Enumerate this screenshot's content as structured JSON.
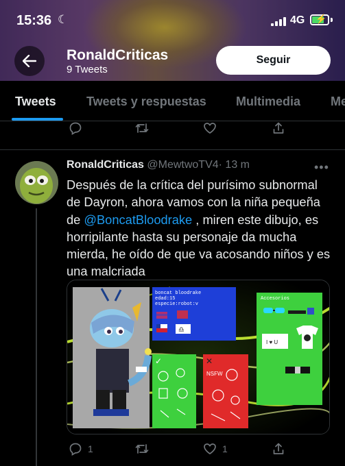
{
  "status_bar": {
    "time": "15:36",
    "network": "4G"
  },
  "header": {
    "name": "RonaldCriticas",
    "tweet_count": "9 Tweets",
    "follow_label": "Seguir"
  },
  "tabs": [
    {
      "label": "Tweets",
      "active": true
    },
    {
      "label": "Tweets y respuestas",
      "active": false
    },
    {
      "label": "Multimedia",
      "active": false
    },
    {
      "label": "Me",
      "active": false
    }
  ],
  "tweet": {
    "name": "RonaldCriticas",
    "handle": "@MewtwoTV4",
    "separator": "·",
    "time": "13 m",
    "text_before": "Después de la crítica del purísimo subnormal de Dayron, ahora vamos con la niña pequeña de ",
    "mention": "@BoncatBloodrake",
    "text_after": " , miren este dibujo, es horripilante hasta su personaje da mucha mierda, he oído de que va acosando niños y es una malcriada",
    "image": {
      "info_lines": [
        "boncat bloodrake",
        "edad:15",
        "especie:robot:v"
      ],
      "accessories_label": "Accesorios",
      "likes_check": "✓",
      "dislikes_cross": "✕",
      "nsfw_text": "NSFW",
      "shirt_text": "I ♥ U"
    },
    "reply_count": "1",
    "retweet_count": "",
    "like_count": "1"
  },
  "colors": {
    "accent": "#1d9bf0",
    "muted": "#71767b",
    "background": "#000000"
  }
}
